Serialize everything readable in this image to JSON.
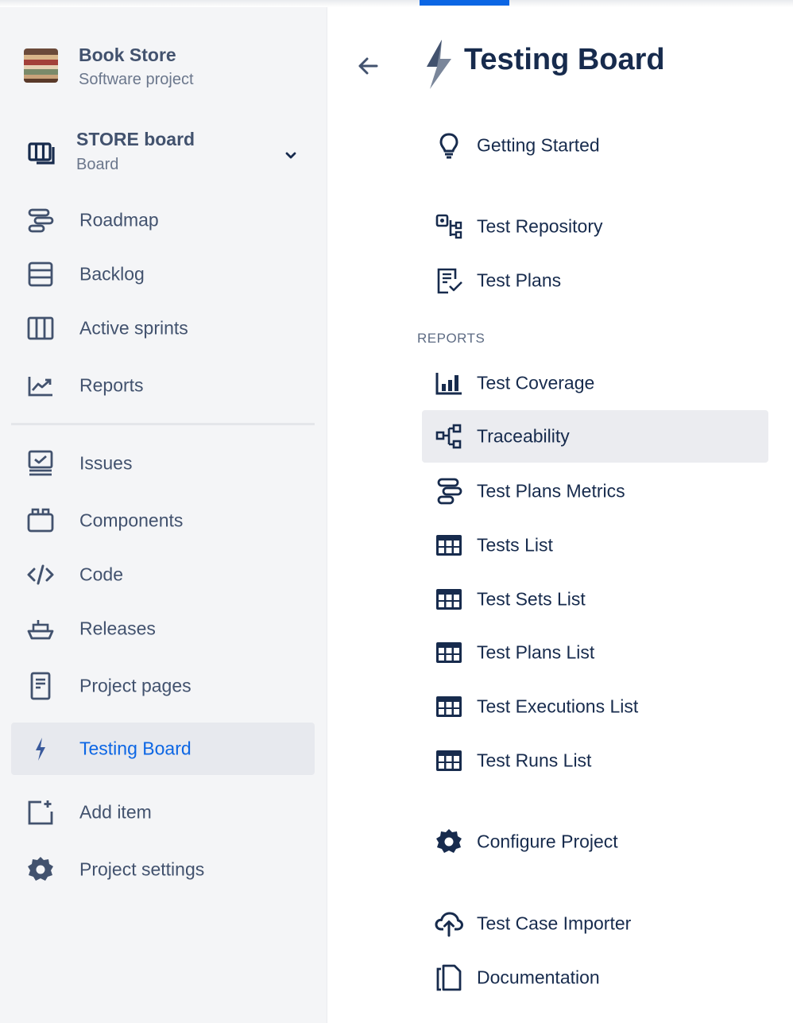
{
  "colors": {
    "accent": "#0c66e4",
    "sidebar_bg": "#f4f5f7",
    "text": "#42526e",
    "heading": "#172b4d",
    "selected_bg": "#ebecf0"
  },
  "project": {
    "name": "Book Store",
    "type": "Software project"
  },
  "board": {
    "name": "STORE board",
    "type": "Board"
  },
  "sidebar": {
    "items": [
      {
        "label": "Roadmap",
        "icon": "roadmap-icon"
      },
      {
        "label": "Backlog",
        "icon": "backlog-icon"
      },
      {
        "label": "Active sprints",
        "icon": "sprints-icon"
      },
      {
        "label": "Reports",
        "icon": "reports-icon"
      },
      {
        "label": "Issues",
        "icon": "issues-icon"
      },
      {
        "label": "Components",
        "icon": "components-icon"
      },
      {
        "label": "Code",
        "icon": "code-icon"
      },
      {
        "label": "Releases",
        "icon": "releases-icon"
      },
      {
        "label": "Project pages",
        "icon": "page-icon"
      },
      {
        "label": "Testing Board",
        "icon": "lightning-icon",
        "active": true
      },
      {
        "label": "Add item",
        "icon": "add-item-icon"
      },
      {
        "label": "Project settings",
        "icon": "gear-icon"
      }
    ]
  },
  "main": {
    "title": "Testing Board",
    "reports_section": "REPORTS",
    "items": [
      {
        "label": "Getting Started",
        "icon": "lightbulb-icon"
      },
      {
        "label": "Test Repository",
        "icon": "repository-icon"
      },
      {
        "label": "Test Plans",
        "icon": "test-plans-icon"
      },
      {
        "label": "Test Coverage",
        "icon": "bar-chart-icon"
      },
      {
        "label": "Traceability",
        "icon": "traceability-icon",
        "selected": true
      },
      {
        "label": "Test Plans Metrics",
        "icon": "metrics-icon"
      },
      {
        "label": "Tests List",
        "icon": "table-icon"
      },
      {
        "label": "Test Sets List",
        "icon": "table-icon"
      },
      {
        "label": "Test Plans List",
        "icon": "table-icon"
      },
      {
        "label": "Test Executions List",
        "icon": "table-icon"
      },
      {
        "label": "Test Runs List",
        "icon": "table-icon"
      },
      {
        "label": "Configure Project",
        "icon": "gear-icon"
      },
      {
        "label": "Test Case Importer",
        "icon": "cloud-upload-icon"
      },
      {
        "label": "Documentation",
        "icon": "documentation-icon"
      }
    ]
  }
}
